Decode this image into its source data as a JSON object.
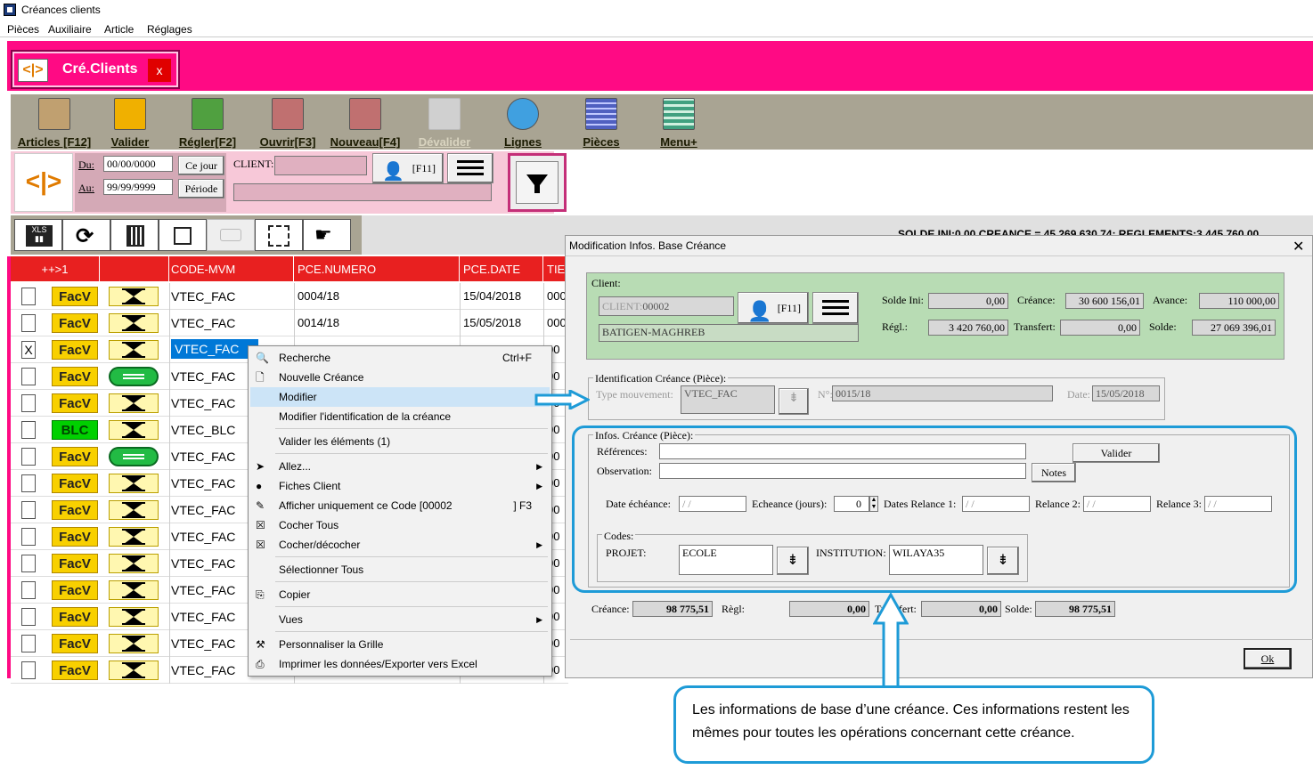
{
  "window": {
    "title": "Créances clients"
  },
  "menubar": [
    "Pièces",
    "Auxiliaire",
    "Article",
    "Réglages"
  ],
  "tab": {
    "label": "Cré.Clients",
    "logo_text": "<|>",
    "close_symbol": "x"
  },
  "toolbar": {
    "items": [
      {
        "label": "Articles [F12]",
        "color": "#c0a070",
        "enabled": true
      },
      {
        "label": "Valider",
        "color": "#f0b000",
        "enabled": true
      },
      {
        "label": "Régler[F2]",
        "color": "#50a040",
        "enabled": true
      },
      {
        "label": "Ouvrir[F3]",
        "color": "#c07070",
        "enabled": true
      },
      {
        "label": "Nouveau[F4]",
        "color": "#c07070",
        "enabled": true
      },
      {
        "label": "Dévalider",
        "color": "#d0d0d0",
        "enabled": false
      },
      {
        "label": "Lignes",
        "color": "#40a0e0",
        "enabled": true
      },
      {
        "label": "Pièces",
        "color": "#5060c0",
        "enabled": true
      },
      {
        "label": "Menu+",
        "color": "#40a080",
        "enabled": true
      }
    ]
  },
  "filter": {
    "du_label": "Du:",
    "du_value": "00/00/0000",
    "au_label": "Au:",
    "au_value": "99/99/9999",
    "ce_jour": "Ce jour",
    "periode": "Période",
    "client_label": "CLIENT:",
    "client_value": "",
    "f11": "[F11]"
  },
  "summary": {
    "text": "SOLDE INI:0,00   CREANCE = 45 269 630,74;   REGLEMENTS:3 445 760,00"
  },
  "grid": {
    "headers": [
      "++>1",
      "",
      "CODE-MVM",
      "PCE.NUMERO",
      "PCE.DATE",
      "TIE"
    ],
    "rows": [
      {
        "checked": "",
        "badge": "FacV",
        "icon": "hourglass",
        "code": "VTEC_FAC",
        "numero": "0004/18",
        "date": "15/04/2018",
        "tie": "000"
      },
      {
        "checked": "",
        "badge": "FacV",
        "icon": "hourglass",
        "code": "VTEC_FAC",
        "numero": "0014/18",
        "date": "15/05/2018",
        "tie": "000"
      },
      {
        "checked": "X",
        "badge": "FacV",
        "icon": "hourglass",
        "code": "VTEC_FAC",
        "numero": "",
        "date": "",
        "tie": "00"
      },
      {
        "checked": "",
        "badge": "FacV",
        "icon": "pill",
        "code": "VTEC_FAC",
        "numero": "",
        "date": "",
        "tie": "00"
      },
      {
        "checked": "",
        "badge": "FacV",
        "icon": "hourglass",
        "code": "VTEC_FAC",
        "numero": "",
        "date": "",
        "tie": "00"
      },
      {
        "checked": "",
        "badge": "BLC",
        "icon": "hourglass",
        "code": "VTEC_BLC",
        "numero": "",
        "date": "",
        "tie": "00"
      },
      {
        "checked": "",
        "badge": "FacV",
        "icon": "pill",
        "code": "VTEC_FAC",
        "numero": "",
        "date": "",
        "tie": "00"
      },
      {
        "checked": "",
        "badge": "FacV",
        "icon": "hourglass",
        "code": "VTEC_FAC",
        "numero": "",
        "date": "",
        "tie": "00"
      },
      {
        "checked": "",
        "badge": "FacV",
        "icon": "hourglass",
        "code": "VTEC_FAC",
        "numero": "",
        "date": "",
        "tie": "00"
      },
      {
        "checked": "",
        "badge": "FacV",
        "icon": "hourglass",
        "code": "VTEC_FAC",
        "numero": "",
        "date": "",
        "tie": "00"
      },
      {
        "checked": "",
        "badge": "FacV",
        "icon": "hourglass",
        "code": "VTEC_FAC",
        "numero": "",
        "date": "",
        "tie": "00"
      },
      {
        "checked": "",
        "badge": "FacV",
        "icon": "hourglass",
        "code": "VTEC_FAC",
        "numero": "",
        "date": "",
        "tie": "00"
      },
      {
        "checked": "",
        "badge": "FacV",
        "icon": "hourglass",
        "code": "VTEC_FAC",
        "numero": "",
        "date": "",
        "tie": "00"
      },
      {
        "checked": "",
        "badge": "FacV",
        "icon": "hourglass",
        "code": "VTEC_FAC",
        "numero": "",
        "date": "",
        "tie": "00"
      },
      {
        "checked": "",
        "badge": "FacV",
        "icon": "hourglass",
        "code": "VTEC_FAC",
        "numero": "",
        "date": "",
        "tie": "00"
      }
    ]
  },
  "context_menu": {
    "items": [
      {
        "label": "Recherche",
        "shortcut": "Ctrl+F",
        "icon": "search-icon"
      },
      {
        "label": "Nouvelle Créance",
        "shortcut": "",
        "icon": "document-icon"
      },
      {
        "label": "Modifier",
        "shortcut": "",
        "icon": "",
        "highlighted": true
      },
      {
        "label": "Modifier l'identification de la créance",
        "shortcut": "",
        "icon": ""
      },
      {
        "label": "Valider les éléments (1)",
        "shortcut": "",
        "icon": ""
      },
      {
        "label": "Allez...",
        "shortcut": "",
        "icon": "goto-icon",
        "submenu": true
      },
      {
        "label": "Fiches Client",
        "shortcut": "",
        "icon": "client-card-icon",
        "submenu": true
      },
      {
        "label": "Afficher uniquement ce Code [00002",
        "shortcut": "] F3",
        "icon": "filter-code-icon"
      },
      {
        "label": "Cocher Tous",
        "shortcut": "",
        "icon": "check-all-icon"
      },
      {
        "label": "Cocher/décocher",
        "shortcut": "",
        "icon": "toggle-check-icon",
        "submenu": true
      },
      {
        "label": "Sélectionner Tous",
        "shortcut": "",
        "icon": ""
      },
      {
        "label": "Copier",
        "shortcut": "",
        "icon": "copy-icon"
      },
      {
        "label": "Vues",
        "shortcut": "",
        "icon": "",
        "submenu": true
      },
      {
        "label": "Personnaliser la Grille",
        "shortcut": "",
        "icon": "tools-icon"
      },
      {
        "label": "Imprimer les données/Exporter vers Excel",
        "shortcut": "",
        "icon": "printer-icon"
      }
    ]
  },
  "dialog": {
    "title": "Modification Infos. Base Créance",
    "close": "✕",
    "client_group": "Client:",
    "client_label": "CLIENT:",
    "client_code": "00002",
    "client_name": "BATIGEN-MAGHREB",
    "f11": "[F11]",
    "solde_ini_label": "Solde Ini:",
    "solde_ini": "0,00",
    "creance_label": "Créance:",
    "creance": "30 600 156,01",
    "avance_label": "Avance:",
    "avance": "110 000,00",
    "regl_label": "Régl.:",
    "regl": "3 420 760,00",
    "transfert_label": "Transfert:",
    "transfert": "0,00",
    "solde_label": "Solde:",
    "solde": "27 069 396,01",
    "ident_group": "Identification Créance (Pièce):",
    "type_mvt_label": "Type mouvement:",
    "type_mvt": "VTEC_FAC",
    "no_label": "N°:",
    "no": "0015/18",
    "date_label": "Date:",
    "date": "15/05/2018",
    "infos_group": "Infos. Créance (Pièce):",
    "references_label": "Références:",
    "references": "",
    "observation_label": "Observation:",
    "observation": "",
    "valider": "Valider",
    "notes": "Notes",
    "date_echeance_label": "Date échéance:",
    "date_echeance": "/ /",
    "echeance_jours_label": "Echeance (jours):",
    "echeance_jours": "0",
    "relance1_label": "Dates Relance 1:",
    "relance1": "/ /",
    "relance2_label": "Relance 2:",
    "relance2": "/ /",
    "relance3_label": "Relance 3:",
    "relance3": "/ /",
    "codes_group": "Codes:",
    "projet_label": "PROJET:",
    "projet": "ECOLE",
    "institution_label": "INSTITUTION:",
    "institution": "WILAYA35",
    "bottom_creance_label": "Créance:",
    "bottom_creance": "98 775,51",
    "bottom_regl_label": "Règl:",
    "bottom_regl": "0,00",
    "bottom_transfert_label": "Transfert:",
    "bottom_transfert": "0,00",
    "bottom_solde_label": "Solde:",
    "bottom_solde": "98 775,51",
    "ok": "Ok"
  },
  "annotation": {
    "text": "Les informations de base d’une créance. Ces informations restent les mêmes pour toutes les opérations concernant cette créance.",
    "color": "#1e9bd7"
  }
}
